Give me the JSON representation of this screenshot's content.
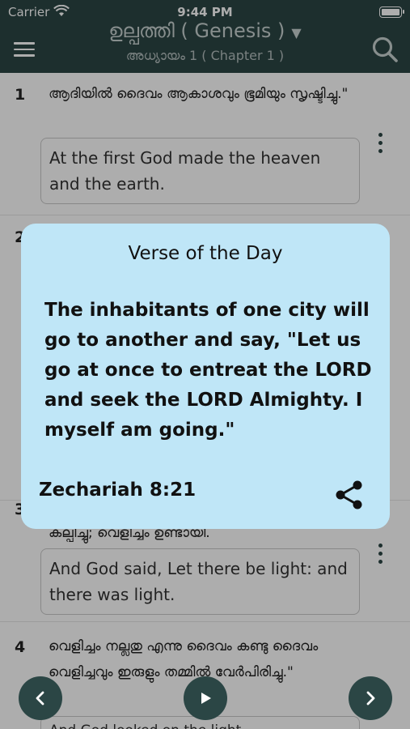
{
  "status_bar": {
    "carrier": "Carrier",
    "time": "9:44 PM"
  },
  "header": {
    "book_title": "ഉല്പത്തി ( Genesis )",
    "chapter_title": "അധ്യായം 1 ( Chapter 1 )"
  },
  "verses": [
    {
      "number": "1",
      "malayalam": "ആദിയിൽ ദൈവം ആകാശവും ഭൂമിയും സൃഷ്ടിച്ചു.\"",
      "english": "At the first God made the heaven and the earth."
    },
    {
      "number": "2",
      "malayalam": "",
      "english": ""
    },
    {
      "number": "3",
      "malayalam": "കല്പിച്ചു; വെളിച്ചം ഉണ്ടായി.",
      "english": "And God said, Let there be light: and there was light."
    },
    {
      "number": "4",
      "malayalam": "വെളിച്ചം നല്ലതു എന്നു ദൈവം കണ്ടു ദൈവം വെളിച്ചവും ഇരുളും തമ്മിൽ വേർപിരിച്ചു.\"",
      "english": "And God looked on the light..."
    }
  ],
  "verse_of_the_day": {
    "heading": "Verse of the Day",
    "text": "The inhabitants of one city will go to another and say, \"Let us go at once to entreat the LORD and seek the LORD Almighty. I myself am going.\"",
    "reference": "Zechariah 8:21"
  },
  "icons": {
    "menu": "hamburger-menu-icon",
    "search": "search-icon",
    "dropdown": "caret-down-icon",
    "more": "more-vertical-icon",
    "share": "share-icon",
    "prev": "chevron-left-icon",
    "play": "play-icon",
    "next": "chevron-right-icon"
  },
  "colors": {
    "primary": "#2b4645",
    "card_background": "#bfe6f7"
  }
}
